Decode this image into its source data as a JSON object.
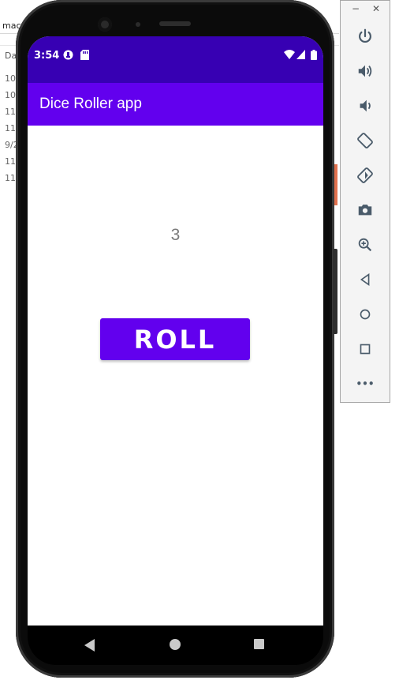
{
  "background_window": {
    "top_text": "mac",
    "header_text": "Da",
    "rows": [
      "10/",
      "10/",
      "11/",
      "11/",
      "9/2",
      "11/",
      "11/"
    ]
  },
  "status_bar": {
    "time": "3:54",
    "icons": [
      "notification-icon",
      "sd-card-icon",
      "wifi-icon",
      "signal-icon",
      "battery-icon"
    ]
  },
  "app_bar": {
    "title": "Dice Roller app"
  },
  "main": {
    "result": "3",
    "roll_button_label": "ROLL"
  },
  "nav_bar": {
    "buttons": [
      "back",
      "home",
      "recents"
    ]
  },
  "emulator_toolbar": {
    "window_controls": [
      "−",
      "✕"
    ],
    "buttons": [
      "power",
      "volume-up",
      "volume-down",
      "rotate-left",
      "rotate-right",
      "screenshot",
      "zoom",
      "back",
      "home",
      "overview",
      "more"
    ],
    "more_label": "•••"
  },
  "colors": {
    "status_bar": "#3700b3",
    "app_bar": "#6200ee",
    "button": "#6200ee"
  }
}
